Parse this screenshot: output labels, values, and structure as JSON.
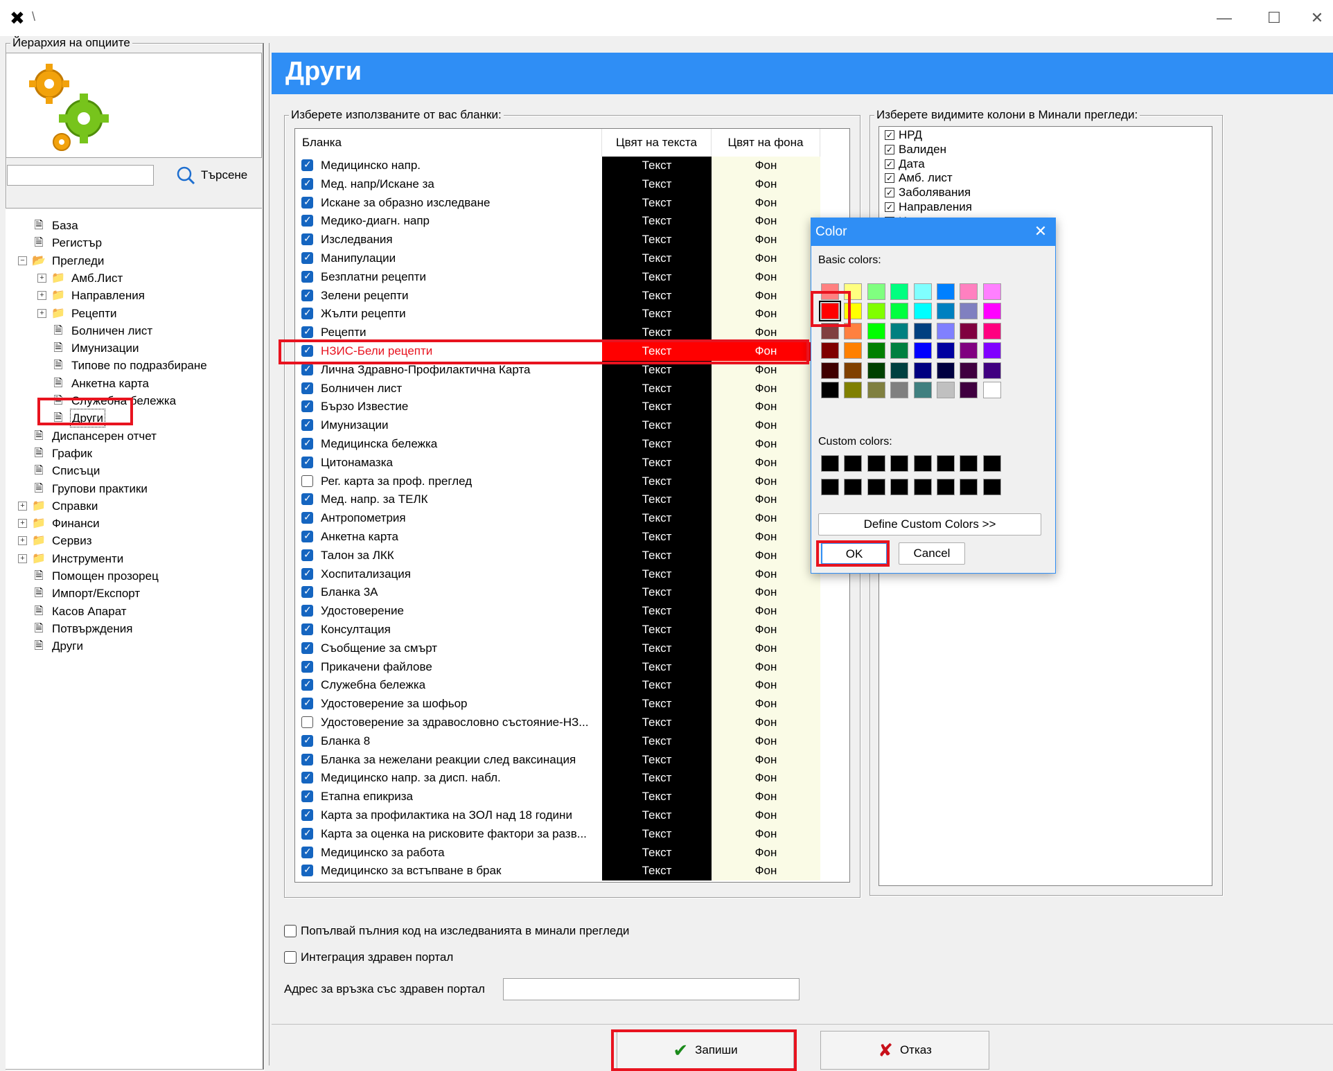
{
  "window": {
    "app_icon": "app-logo-icon",
    "title": "\\",
    "minimize_glyph": "—",
    "maximize_glyph": "☐",
    "close_glyph": "✕"
  },
  "left": {
    "group_title": "Йерархия на опциите",
    "search_placeholder": "",
    "search_label": "Търсене",
    "tree": [
      {
        "label": "База",
        "level": 0,
        "type": "doc",
        "exp": ""
      },
      {
        "label": "Регистър",
        "level": 0,
        "type": "doc",
        "exp": ""
      },
      {
        "label": "Прегледи",
        "level": 0,
        "type": "folder-open",
        "exp": "−"
      },
      {
        "label": "Амб.Лист",
        "level": 1,
        "type": "folder",
        "exp": "+"
      },
      {
        "label": "Направления",
        "level": 1,
        "type": "folder",
        "exp": "+"
      },
      {
        "label": "Рецепти",
        "level": 1,
        "type": "folder",
        "exp": "+"
      },
      {
        "label": "Болничен лист",
        "level": 1,
        "type": "doc",
        "exp": ""
      },
      {
        "label": "Имунизации",
        "level": 1,
        "type": "doc",
        "exp": ""
      },
      {
        "label": "Типове по подразбиране",
        "level": 1,
        "type": "doc",
        "exp": ""
      },
      {
        "label": "Анкетна карта",
        "level": 1,
        "type": "doc",
        "exp": ""
      },
      {
        "label": "Служебна бележка",
        "level": 1,
        "type": "doc",
        "exp": ""
      },
      {
        "label": "Други",
        "level": 1,
        "type": "doc",
        "exp": "",
        "selected": true
      },
      {
        "label": "Диспансерен отчет",
        "level": 0,
        "type": "doc",
        "exp": ""
      },
      {
        "label": "График",
        "level": 0,
        "type": "doc",
        "exp": ""
      },
      {
        "label": "Списъци",
        "level": 0,
        "type": "doc",
        "exp": ""
      },
      {
        "label": "Групови практики",
        "level": 0,
        "type": "doc",
        "exp": ""
      },
      {
        "label": "Справки",
        "level": 0,
        "type": "folder",
        "exp": "+"
      },
      {
        "label": "Финанси",
        "level": 0,
        "type": "folder",
        "exp": "+"
      },
      {
        "label": "Сервиз",
        "level": 0,
        "type": "folder",
        "exp": "+"
      },
      {
        "label": "Инструменти",
        "level": 0,
        "type": "folder",
        "exp": "+"
      },
      {
        "label": "Помощен прозорец",
        "level": 0,
        "type": "doc",
        "exp": ""
      },
      {
        "label": "Импорт/Експорт",
        "level": 0,
        "type": "doc",
        "exp": ""
      },
      {
        "label": "Касов Апарат",
        "level": 0,
        "type": "doc",
        "exp": ""
      },
      {
        "label": "Потвърждения",
        "level": 0,
        "type": "doc",
        "exp": ""
      },
      {
        "label": "Други",
        "level": 0,
        "type": "doc",
        "exp": ""
      }
    ]
  },
  "main": {
    "header_title": "Други",
    "forms_group_title": "Изберете използваните от вас бланки:",
    "forms_columns": [
      "Бланка",
      "Цвят на текста",
      "Цвят на фона"
    ],
    "text_cell": "Текст",
    "bg_cell": "Фон",
    "forms": [
      {
        "name": "Медицинско напр.",
        "checked": true
      },
      {
        "name": "Мед. напр/Искане за",
        "checked": true
      },
      {
        "name": "Искане за образно изследване",
        "checked": true
      },
      {
        "name": "Медико-диагн. напр",
        "checked": true
      },
      {
        "name": "Изследвания",
        "checked": true
      },
      {
        "name": "Манипулации",
        "checked": true
      },
      {
        "name": "Безплатни рецепти",
        "checked": true
      },
      {
        "name": "Зелени рецепти",
        "checked": true
      },
      {
        "name": "Жълти рецепти",
        "checked": true
      },
      {
        "name": "Рецепти",
        "checked": true
      },
      {
        "name": "НЗИС-Бели рецепти",
        "checked": true,
        "highlight": true
      },
      {
        "name": "Лична Здравно-Профилактична Карта",
        "checked": true
      },
      {
        "name": "Болничен лист",
        "checked": true
      },
      {
        "name": "Бързо Известие",
        "checked": true
      },
      {
        "name": "Имунизации",
        "checked": true
      },
      {
        "name": "Медицинска бележка",
        "checked": true
      },
      {
        "name": "Цитонамазка",
        "checked": true
      },
      {
        "name": "Рег. карта за проф. преглед",
        "checked": false
      },
      {
        "name": "Мед. напр. за ТЕЛК",
        "checked": true
      },
      {
        "name": "Антропометрия",
        "checked": true
      },
      {
        "name": "Анкетна карта",
        "checked": true
      },
      {
        "name": "Талон за ЛКК",
        "checked": true
      },
      {
        "name": "Хоспитализация",
        "checked": true
      },
      {
        "name": "Бланка 3А",
        "checked": true
      },
      {
        "name": "Удостоверение",
        "checked": true
      },
      {
        "name": "Консултация",
        "checked": true
      },
      {
        "name": "Съобщение за смърт",
        "checked": true
      },
      {
        "name": "Прикачени файлове",
        "checked": true
      },
      {
        "name": "Служебна бележка",
        "checked": true
      },
      {
        "name": "Удостоверение за шофьор",
        "checked": true
      },
      {
        "name": "Удостоверение за здравословно състояние-НЗ...",
        "checked": false
      },
      {
        "name": "Бланка 8",
        "checked": true
      },
      {
        "name": "Бланка за нежелани реакции след ваксинация",
        "checked": true
      },
      {
        "name": "Медицинско напр. за дисп. набл.",
        "checked": true
      },
      {
        "name": "Етапна епикриза",
        "checked": true
      },
      {
        "name": "Карта за профилактика на ЗОЛ над 18 години",
        "checked": true
      },
      {
        "name": "Карта за оценка на рисковите фактори за разв...",
        "checked": true
      },
      {
        "name": "Медицинско за работа",
        "checked": true
      },
      {
        "name": "Медицинско за встъпване в брак",
        "checked": true
      }
    ],
    "cols_group_title": "Изберете видимите колони в Минали прегледи:",
    "visible_columns": [
      {
        "label": "НРД",
        "checked": true
      },
      {
        "label": "Валиден",
        "checked": true
      },
      {
        "label": "Дата",
        "checked": true
      },
      {
        "label": "Амб. лист",
        "checked": true
      },
      {
        "label": "Заболявания",
        "checked": true
      },
      {
        "label": "Направления",
        "checked": true
      },
      {
        "label": "И",
        "checked": true
      }
    ],
    "opt_full_code": "Попълвай пълния код на изследванията в минали прегледи",
    "opt_portal": "Интеграция здравен портал",
    "portal_address_label": "Адрес за връзка със здравен портал",
    "portal_address_value": "",
    "save_label": "Запиши",
    "cancel_label": "Отказ"
  },
  "color_dialog": {
    "title": "Color",
    "basic_label": "Basic colors:",
    "custom_label": "Custom colors:",
    "define_label": "Define Custom Colors >>",
    "ok_label": "OK",
    "cancel_label": "Cancel",
    "selected_index": 8,
    "basic_colors": [
      "#ff8080",
      "#ffff80",
      "#80ff80",
      "#00ff80",
      "#80ffff",
      "#0080ff",
      "#ff80c0",
      "#ff80ff",
      "#ff0000",
      "#ffff00",
      "#80ff00",
      "#00ff40",
      "#00ffff",
      "#0080c0",
      "#8080c0",
      "#ff00ff",
      "#804040",
      "#ff8040",
      "#00ff00",
      "#008080",
      "#004080",
      "#8080ff",
      "#800040",
      "#ff0080",
      "#800000",
      "#ff8000",
      "#008000",
      "#008040",
      "#0000ff",
      "#0000a0",
      "#800080",
      "#8000ff",
      "#400000",
      "#804000",
      "#004000",
      "#004040",
      "#000080",
      "#000040",
      "#400040",
      "#400080",
      "#000000",
      "#808000",
      "#808040",
      "#808080",
      "#408080",
      "#c0c0c0",
      "#400040",
      "#ffffff"
    ],
    "custom_colors": [
      "#000000",
      "#000000",
      "#000000",
      "#000000",
      "#000000",
      "#000000",
      "#000000",
      "#000000",
      "#000000",
      "#000000",
      "#000000",
      "#000000",
      "#000000",
      "#000000",
      "#000000",
      "#000000"
    ]
  }
}
